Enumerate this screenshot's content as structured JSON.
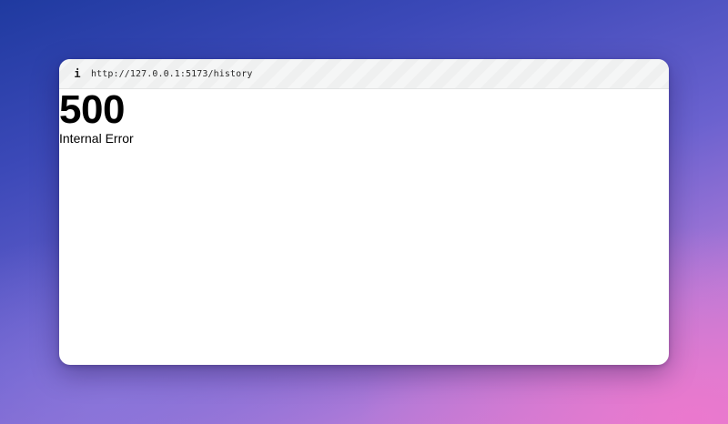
{
  "browser": {
    "info_icon": "info-icon",
    "url": "http://127.0.0.1:5173/history"
  },
  "page": {
    "status_code": "500",
    "message": "Internal Error"
  }
}
